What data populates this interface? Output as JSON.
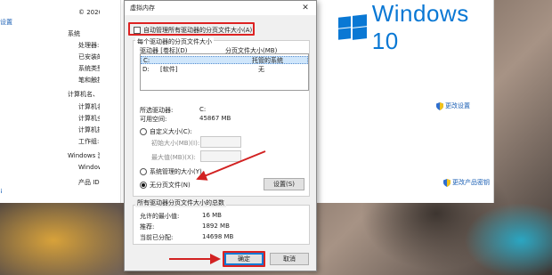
{
  "system_window": {
    "copyright": "© 2020",
    "settings_link_partial": "设置",
    "section_system": "系统",
    "processor_label": "处理器:",
    "installed_ram_label": "已安装的",
    "system_type_label": "系统类型",
    "pen_touch_label": "笔和触控",
    "section_computer": "计算机名、",
    "computer_name_label": "计算机名",
    "computer_full_label": "计算机全",
    "computer_desc_label": "计算机描",
    "workgroup_label": "工作组:",
    "section_activation": "Windows 激",
    "windows_label": "Windows",
    "product_id_label": "产品 ID:",
    "change_settings_link": "更改设置",
    "change_key_link": "更改产品密钥",
    "windows_brand": "Windows 10"
  },
  "dialog": {
    "title": "虚拟内存",
    "close_glyph": "✕",
    "auto_manage_label": "自动管理所有驱动器的分页文件大小(A)",
    "auto_manage_checked": false,
    "group_drives_label": "每个驱动器的分页文件大小",
    "col_drive": "驱动器 [卷标](D)",
    "col_size": "分页文件大小(MB)",
    "drives": [
      {
        "drive": "C:",
        "label": "",
        "size": "托管的系统"
      },
      {
        "drive": "D:",
        "label": "[软件]",
        "size": "无"
      }
    ],
    "selected_drive_label": "所选驱动器:",
    "selected_drive_value": "C:",
    "available_space_label": "可用空间:",
    "available_space_value": "45867 MB",
    "custom_size_label": "自定义大小(C):",
    "initial_size_label": "初始大小(MB)(I):",
    "max_size_label": "最大值(MB)(X):",
    "system_managed_label": "系统管理的大小(Y)",
    "no_paging_label": "无分页文件(N)",
    "selected_option": "no_paging",
    "set_button": "设置(S)",
    "total_group_label": "所有驱动器分页文件大小的总数",
    "min_allowed_label": "允许的最小值:",
    "min_allowed_value": "16 MB",
    "recommended_label": "推荐:",
    "recommended_value": "1892 MB",
    "current_label": "当前已分配:",
    "current_value": "14698 MB",
    "ok_button": "确定",
    "cancel_button": "取消"
  },
  "colors": {
    "annotation_red": "#d22222",
    "windows_blue": "#0a78d4",
    "selection_blue": "#cfe6fb"
  }
}
